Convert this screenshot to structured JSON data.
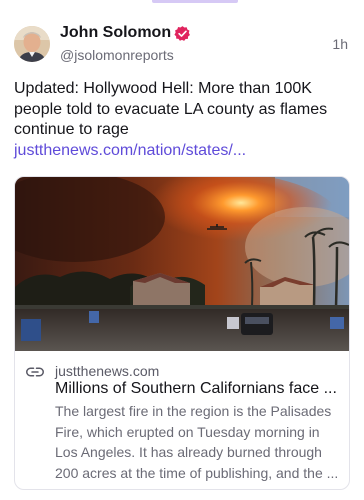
{
  "author": {
    "name": "John Solomon",
    "handle": "@jsolomonreports",
    "verified": true
  },
  "post": {
    "timestamp": "1h",
    "text": "Updated: Hollywood Hell: More than 100K people told to evacuate LA county as flames continue to rage ",
    "link_text": "justthenews.com/nation/states/..."
  },
  "link_card": {
    "domain": "justthenews.com",
    "title": "Millions of Southern Californians face ...",
    "description": "The largest fire in the region is the Palisades Fire, which erupted on Tuesday morning in Los Angeles. It has already burned through 200 acres at the time of publishing, and the ..."
  },
  "colors": {
    "link": "#5f4bd9",
    "verified_badge": "#e0245e",
    "muted_text": "#6b6b76"
  },
  "icons": {
    "verified": "verified-badge-icon",
    "link": "link-icon"
  }
}
